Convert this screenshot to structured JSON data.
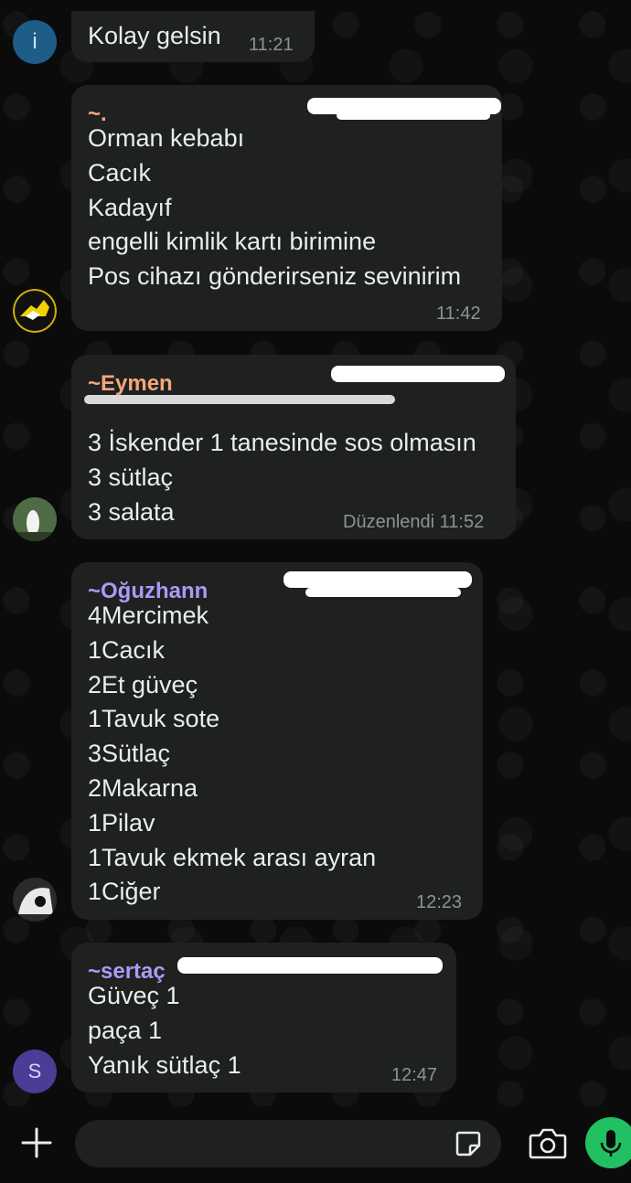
{
  "colors": {
    "background": "#0b0b0b",
    "bubble": "#1f2020",
    "text": "#e9edef",
    "timestamp": "#8c9396",
    "sender_tilde": "#f2a77a",
    "sender_eymen": "#f2a77a",
    "sender_oguzhan": "#a99bf5",
    "sender_sertac": "#a99bf5",
    "mic_green": "#21c063",
    "avatar_i": "#1d5d87",
    "avatar_s": "#4a3d96"
  },
  "messages": [
    {
      "avatar_letter": "i",
      "sender": "",
      "lines": [
        "Kolay gelsin"
      ],
      "time": "11:21"
    },
    {
      "avatar_icon": "team-logo-icon",
      "sender": "~.",
      "lines": [
        "Orman kebabı",
        "Cacık",
        "Kadayıf",
        "engelli kimlik kartı birimine",
        "Pos cihazı gönderirseniz sevinirim"
      ],
      "time": "11:42"
    },
    {
      "avatar_icon": "photo-avatar-icon",
      "sender": "~Eymen",
      "lines": [
        "3 İskender 1 tanesinde sos olmasın",
        "3 sütlaç",
        "3 salata"
      ],
      "time": "Düzenlendi 11:52"
    },
    {
      "avatar_icon": "photo-avatar-icon",
      "sender": "~Oğuzhann",
      "lines": [
        "4Mercimek",
        "1Cacık",
        "2Et güveç",
        "1Tavuk sote",
        "3Sütlaç",
        "2Makarna",
        "1Pilav",
        "1Tavuk ekmek arası ayran",
        "1Ciğer"
      ],
      "time": "12:23"
    },
    {
      "avatar_letter": "S",
      "sender": "~sertaç",
      "lines": [
        "Güveç 1",
        "paça 1",
        "Yanık sütlaç 1"
      ],
      "time": "12:47"
    }
  ],
  "composer": {
    "add_icon": "plus-icon",
    "sticker_icon": "sticker-icon",
    "camera_icon": "camera-icon",
    "mic_icon": "microphone-icon",
    "placeholder": ""
  }
}
